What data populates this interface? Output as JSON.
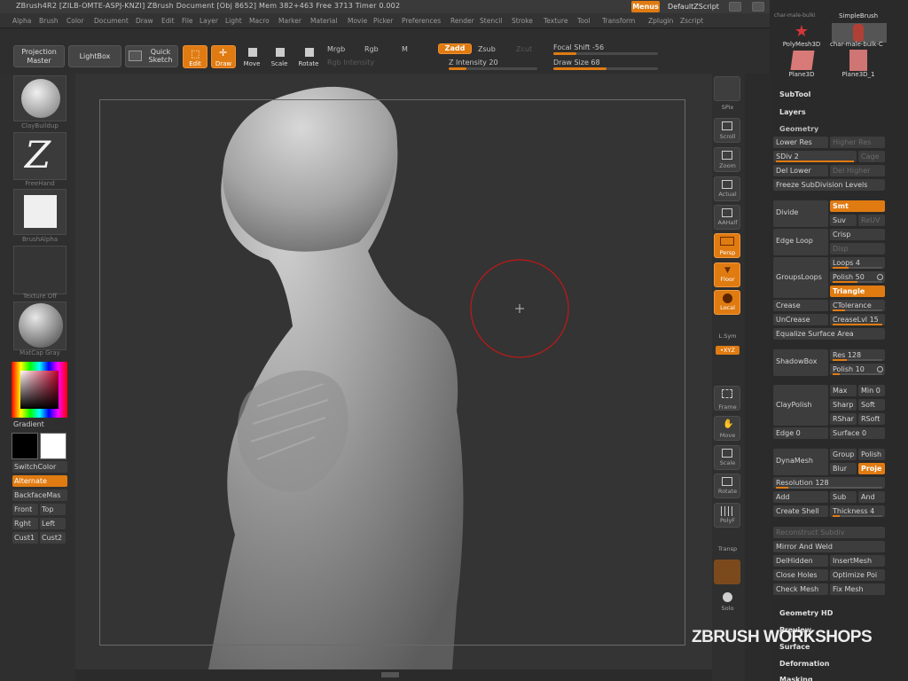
{
  "titlebar": {
    "title": "ZBrush4R2  [ZILB-OMTE-ASPJ-KNZI]   ZBrush Document   [Obj 8652] Mem 382+463 Free 3713 Timer 0.002",
    "menus_btn": "Menus",
    "script_btn": "DefaultZScript"
  },
  "menubar": [
    "Alpha",
    "Brush",
    "Color",
    "Document",
    "Draw",
    "Edit",
    "File",
    "Layer",
    "Light",
    "Macro",
    "Marker",
    "Material",
    "Movie",
    "Picker",
    "Preferences",
    "Render",
    "Stencil",
    "Stroke",
    "Texture",
    "Tool",
    "Transform",
    "Zplugin",
    "Zscript"
  ],
  "toolbar": {
    "projection_master": "Projection Master",
    "lightbox": "LightBox",
    "quick_sketch": "Quick Sketch",
    "edit": "Edit",
    "draw": "Draw",
    "move": "Move",
    "scale": "Scale",
    "rotate": "Rotate",
    "mrgb": "Mrgb",
    "rgb": "Rgb",
    "m": "M",
    "rgb_intensity": "Rgb Intensity",
    "zadd": "Zadd",
    "zsub": "Zsub",
    "zcut": "Zcut",
    "z_intensity": "Z Intensity 20",
    "z_intensity_value": 20,
    "focal_shift": "Focal Shift -56",
    "focal_shift_value": -56,
    "draw_size": "Draw Size 68",
    "draw_size_value": 68
  },
  "leftshelf": {
    "brush_caption": "ClayBuildup",
    "stroke_caption": "FreeHand",
    "alpha_caption": "BrushAlpha",
    "texture_caption": "Texture Off",
    "material_caption": "MatCap Gray",
    "gradient": "Gradient",
    "switchcolor": "SwitchColor",
    "alternate": "Alternate",
    "backfacemask": "BackfaceMas",
    "front": "Front",
    "top": "Top",
    "right": "Rght",
    "left": "Left",
    "cust1": "Cust1",
    "cust2": "Cust2",
    "colors": {
      "main": "#000000",
      "secondary": "#ffffff"
    }
  },
  "rightshelf": {
    "spix": "SPix",
    "scroll": "Scroll",
    "zoom": "Zoom",
    "actual": "Actual",
    "aahalf": "AAHalf",
    "persp": "Persp",
    "floor": "Floor",
    "local": "Local",
    "lsym": "L.Sym",
    "xyz": "•XYZ",
    "frame": "Frame",
    "move": "Move",
    "scale": "Scale",
    "rotate": "Rotate",
    "polyf": "PolyF",
    "transp": "Transp",
    "solo": "Solo"
  },
  "panel": {
    "thumbs": {
      "top_label_left": "char-male-bulki",
      "top_label_right": "SimpleBrush",
      "polymesh": "PolyMesh3D",
      "char": "char-male-bulk-C",
      "plane": "Plane3D",
      "plane1": "Plane3D_1"
    },
    "subtool": "SubTool",
    "layers": "Layers",
    "geometry": "Geometry",
    "lower_res": "Lower Res",
    "higher_res": "Higher Res",
    "sdiv": "SDiv 2",
    "sdiv_value": 2,
    "cage": "Cage",
    "del_lower": "Del Lower",
    "del_higher": "Del Higher",
    "freeze": "Freeze SubDivision Levels",
    "divide": "Divide",
    "smt": "Smt",
    "suv": "Suv",
    "reuv": "ReUV",
    "edge_loop": "Edge Loop",
    "crisp": "Crisp",
    "disp": "Disp",
    "groupsloops": "GroupsLoops",
    "loops": "Loops 4",
    "polish50": "Polish 50",
    "triangle": "Triangle",
    "crease": "Crease",
    "ctolerance": "CTolerance",
    "uncrease": "UnCrease",
    "creaselvl": "CreaseLvl 15",
    "equalize": "Equalize Surface Area",
    "shadowbox": "ShadowBox",
    "res": "Res 128",
    "polish10": "Polish 10",
    "claypolish": "ClayPolish",
    "max": "Max",
    "min": "Min 0",
    "sharp": "Sharp",
    "soft": "Soft",
    "rshar": "RShar",
    "rsoft": "RSoft",
    "edge": "Edge 0",
    "surface": "Surface 0",
    "dynamesh": "DynaMesh",
    "group": "Group",
    "polish": "Polish",
    "blur": "Blur",
    "project": "Proje",
    "resolution": "Resolution 128",
    "add": "Add",
    "sub": "Sub",
    "and": "And",
    "create_shell": "Create Shell",
    "thickness": "Thickness 4",
    "reconstruct": "Reconstruct Subdiv",
    "mirror_weld": "Mirror And Weld",
    "delhidden": "DelHidden",
    "insertmesh": "InsertMesh",
    "close_holes": "Close Holes",
    "optimize": "Optimize Poi",
    "check_mesh": "Check Mesh",
    "fix_mesh": "Fix Mesh",
    "geometry_hd": "Geometry HD",
    "preview": "Preview",
    "surface_head": "Surface",
    "deformation": "Deformation",
    "masking": "Masking"
  },
  "watermark": "ZBRUSH WORKSHOPS"
}
